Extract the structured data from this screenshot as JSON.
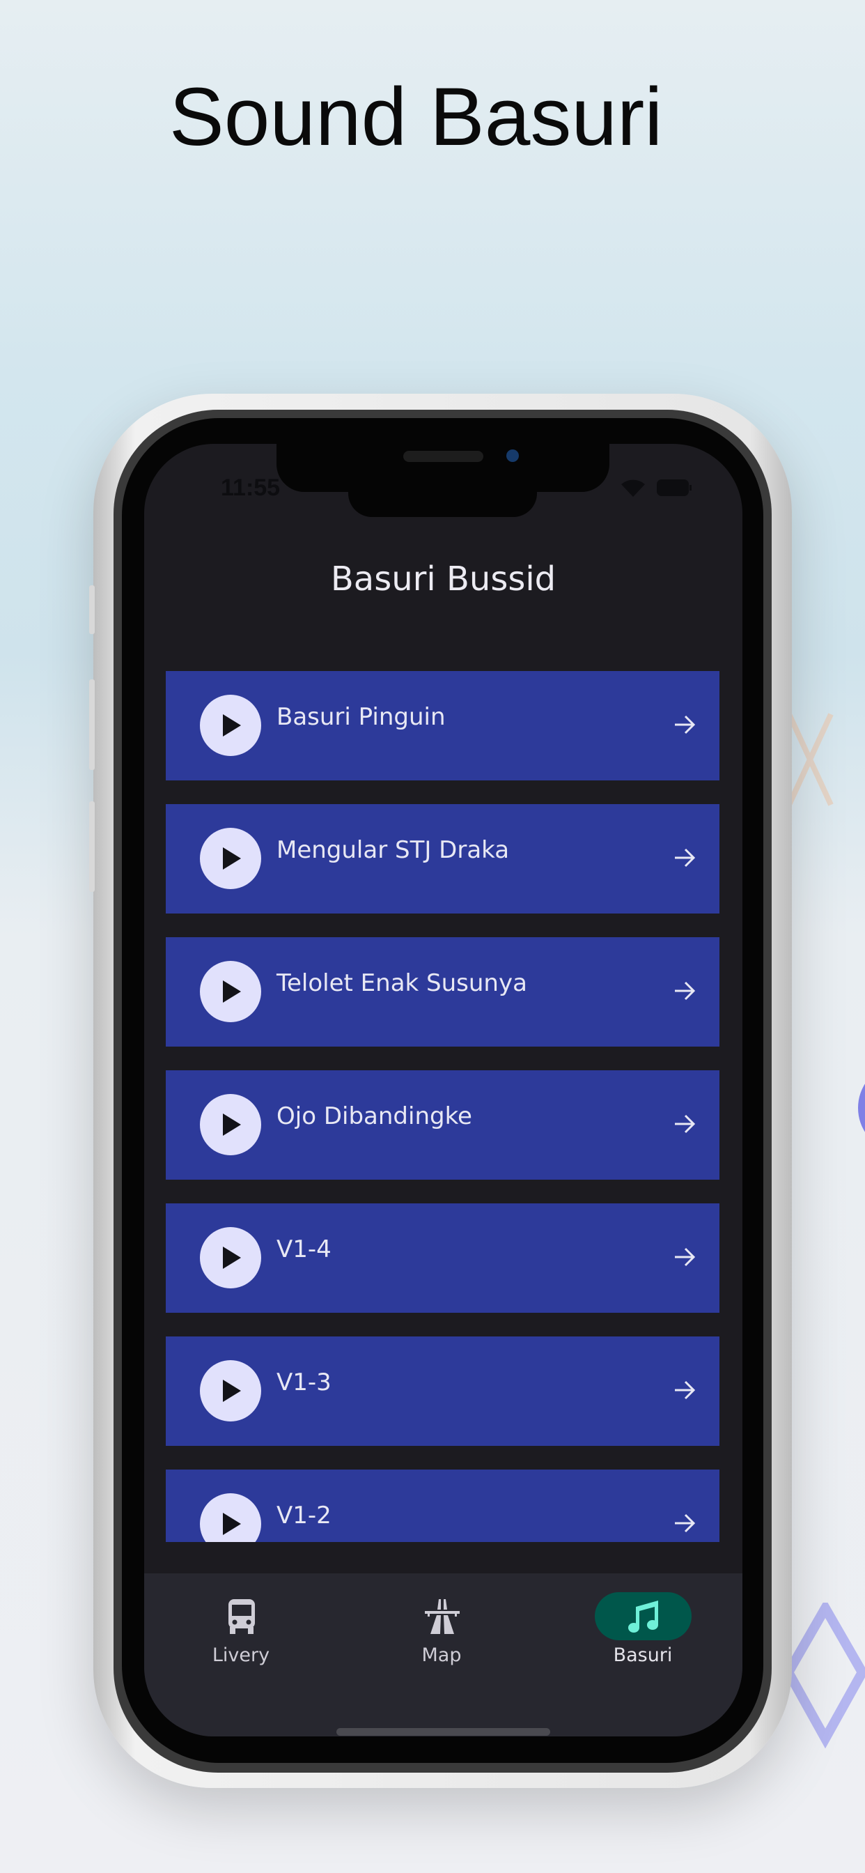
{
  "promo": {
    "title": "Sound Basuri"
  },
  "status_bar": {
    "time": "11:55",
    "icons": [
      "wifi-icon",
      "battery-icon"
    ]
  },
  "header": {
    "title": "Basuri Bussid"
  },
  "list": {
    "items": [
      {
        "label": "Basuri Pinguin"
      },
      {
        "label": "Mengular STJ Draka"
      },
      {
        "label": "Telolet Enak Susunya"
      },
      {
        "label": "Ojo Dibandingke"
      },
      {
        "label": "V1-4"
      },
      {
        "label": "V1-3"
      },
      {
        "label": "V1-2"
      }
    ]
  },
  "bottom_nav": {
    "items": [
      {
        "label": "Livery",
        "icon": "bus-icon",
        "active": false
      },
      {
        "label": "Map",
        "icon": "highway-icon",
        "active": false
      },
      {
        "label": "Basuri",
        "icon": "music-note-icon",
        "active": true
      }
    ]
  },
  "colors": {
    "list_item": "#2d3a9a",
    "screen_bg": "#1c1b20",
    "nav_bg": "#27272f",
    "active_pill": "#00574b",
    "active_icon": "#6ff0d8"
  }
}
